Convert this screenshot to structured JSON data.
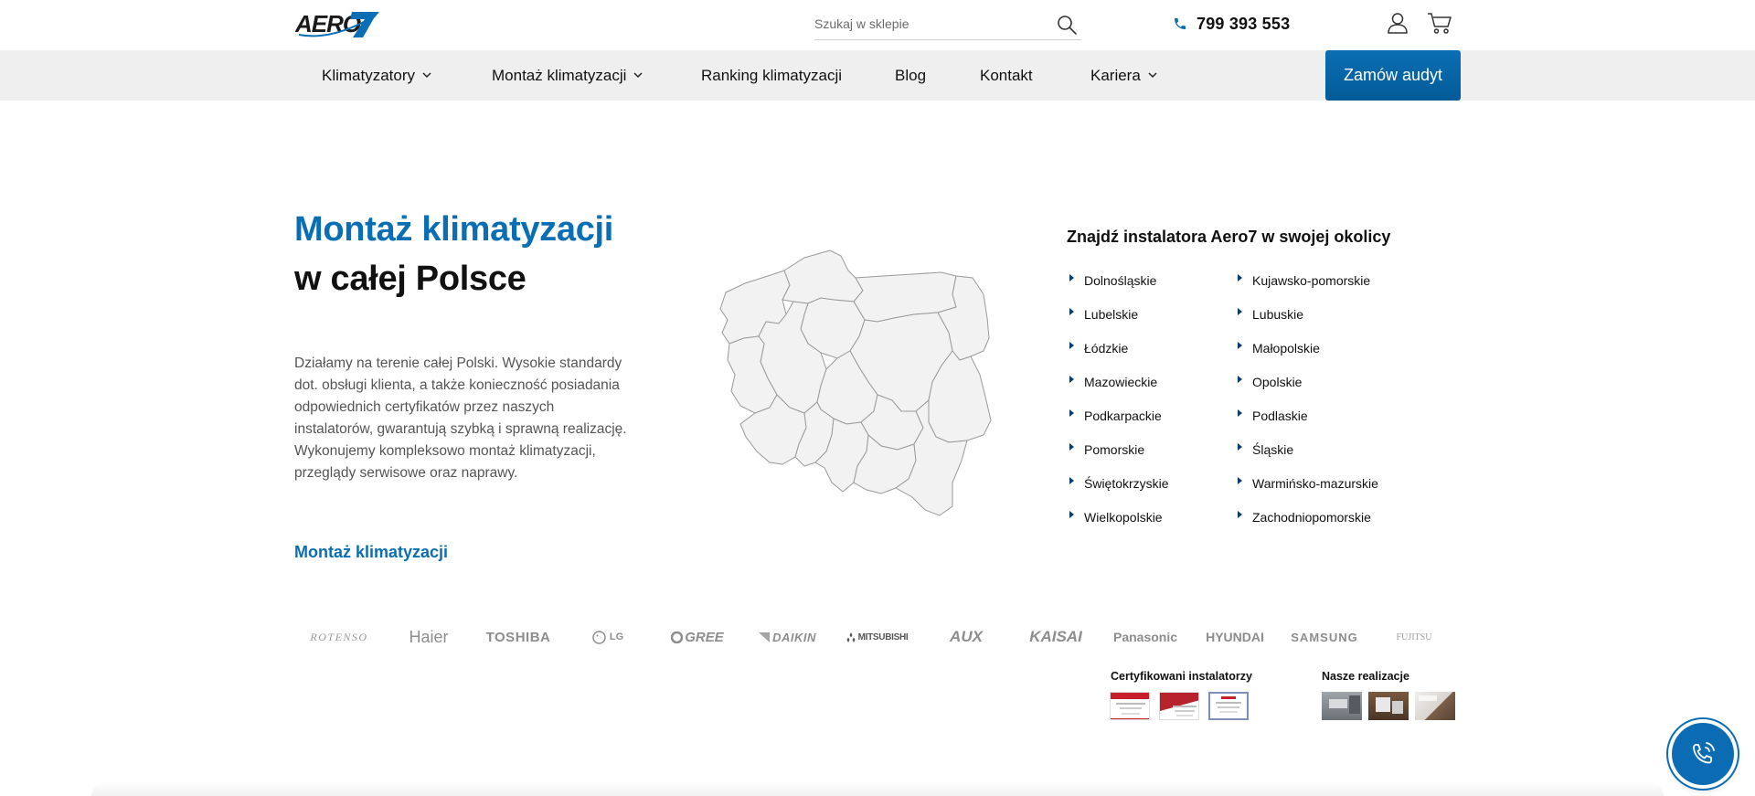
{
  "header": {
    "logo_text": "AERO7",
    "search_placeholder": "Szukaj w sklepie",
    "phone": "799 393 553",
    "brand_color": "#0a6eb4"
  },
  "nav": {
    "items": [
      {
        "label": "Klimatyzatory",
        "dropdown": true
      },
      {
        "label": "Montaż klimatyzacji",
        "dropdown": true
      },
      {
        "label": "Ranking klimatyzacji",
        "dropdown": false
      },
      {
        "label": "Blog",
        "dropdown": false
      },
      {
        "label": "Kontakt",
        "dropdown": false
      },
      {
        "label": "Kariera",
        "dropdown": true
      }
    ],
    "cta": "Zamów audyt"
  },
  "hero": {
    "title_line1": "Montaż klimatyzacji",
    "title_line2": "w całej Polsce",
    "description": "Działamy na terenie całej Polski. Wysokie standardy dot. obsługi klienta, a także konieczność posiadania odpowiednich certyfikatów przez naszych instalatorów, gwarantują szybką i sprawną realizację. Wykonujemy kompleksowo montaż klimatyzacji, przeglądy serwisowe oraz naprawy.",
    "link": "Montaż klimatyzacji"
  },
  "installers": {
    "title": "Znajdź instalatora Aero7 w swojej okolicy",
    "regions": [
      "Dolnośląskie",
      "Kujawsko-pomorskie",
      "Lubelskie",
      "Lubuskie",
      "Łódzkie",
      "Małopolskie",
      "Mazowieckie",
      "Opolskie",
      "Podkarpackie",
      "Podlaskie",
      "Pomorskie",
      "Śląskie",
      "Świętokrzyskie",
      "Warmińsko-mazurskie",
      "Wielkopolskie",
      "Zachodniopomorskie"
    ]
  },
  "brands": [
    "ROTENSO",
    "Haier",
    "TOSHIBA",
    "LG",
    "GREE",
    "DAIKIN",
    "MITSUBISHI",
    "AUX",
    "KAISAI",
    "Panasonic",
    "HYUNDAI",
    "SAMSUNG",
    "FUJITSU"
  ],
  "footer_badges": {
    "certified": "Certyfikowani instalatorzy",
    "realizations": "Nasze realizacje"
  }
}
